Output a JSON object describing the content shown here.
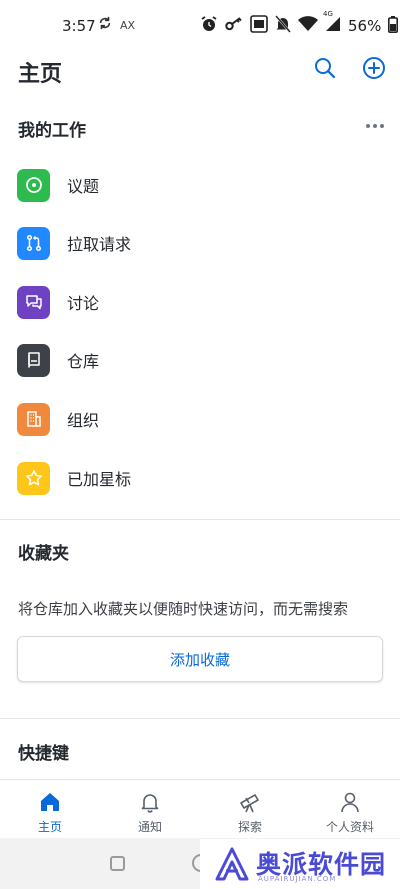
{
  "status_bar": {
    "time": "3:57",
    "ax_label": "AX",
    "battery": "56%",
    "network": "4G"
  },
  "header": {
    "title": "主页"
  },
  "my_work": {
    "title": "我的工作",
    "items": [
      {
        "label": "议题",
        "color": "#2dba4e",
        "icon": "issue-icon"
      },
      {
        "label": "拉取请求",
        "color": "#2188ff",
        "icon": "pull-request-icon"
      },
      {
        "label": "讨论",
        "color": "#6f42c1",
        "icon": "discussion-icon"
      },
      {
        "label": "仓库",
        "color": "#3d4249",
        "icon": "repo-icon"
      },
      {
        "label": "组织",
        "color": "#f0883e",
        "icon": "organization-icon"
      },
      {
        "label": "已加星标",
        "color": "#ffc61a",
        "icon": "star-icon"
      }
    ]
  },
  "favorites": {
    "title": "收藏夹",
    "description": "将仓库加入收藏夹以便随时快速访问，而无需搜索",
    "add_button": "添加收藏"
  },
  "shortcuts": {
    "title": "快捷键"
  },
  "bottom_nav": {
    "items": [
      {
        "label": "主页",
        "icon": "home-icon",
        "active": true
      },
      {
        "label": "通知",
        "icon": "bell-icon",
        "active": false
      },
      {
        "label": "探索",
        "icon": "telescope-icon",
        "active": false
      },
      {
        "label": "个人资料",
        "icon": "person-icon",
        "active": false
      }
    ]
  },
  "watermark": {
    "text": "奥派软件园",
    "sub": "AUPAIRUJIAN.COM"
  },
  "colors": {
    "accent": "#0969da",
    "text": "#24292f"
  }
}
